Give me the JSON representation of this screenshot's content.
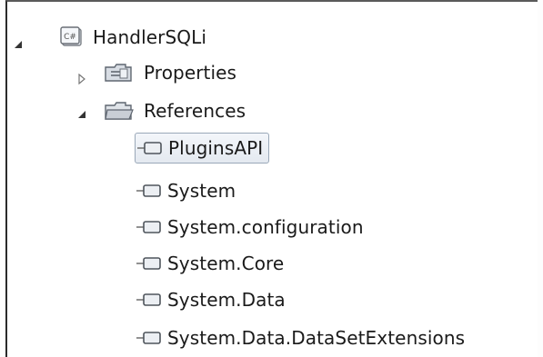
{
  "solution_explorer": {
    "project": {
      "label": "HandlerSQLi",
      "icon": "csharp-project-icon",
      "expanded": true
    },
    "properties": {
      "label": "Properties",
      "icon": "properties-folder-icon",
      "expanded": false
    },
    "references": {
      "label": "References",
      "icon": "references-folder-icon",
      "expanded": true,
      "items": [
        {
          "label": "PluginsAPI",
          "icon": "reference-icon",
          "selected": true
        },
        {
          "label": "System",
          "icon": "reference-icon",
          "selected": false
        },
        {
          "label": "System.configuration",
          "icon": "reference-icon",
          "selected": false
        },
        {
          "label": "System.Core",
          "icon": "reference-icon",
          "selected": false
        },
        {
          "label": "System.Data",
          "icon": "reference-icon",
          "selected": false
        },
        {
          "label": "System.Data.DataSetExtensions",
          "icon": "reference-icon",
          "selected": false
        }
      ]
    }
  },
  "colors": {
    "selection_border": "#9aa8b8",
    "selection_fill": "#e8edf3",
    "icon_gray": "#6b6b6b",
    "folder_fill": "#d8dde4"
  }
}
